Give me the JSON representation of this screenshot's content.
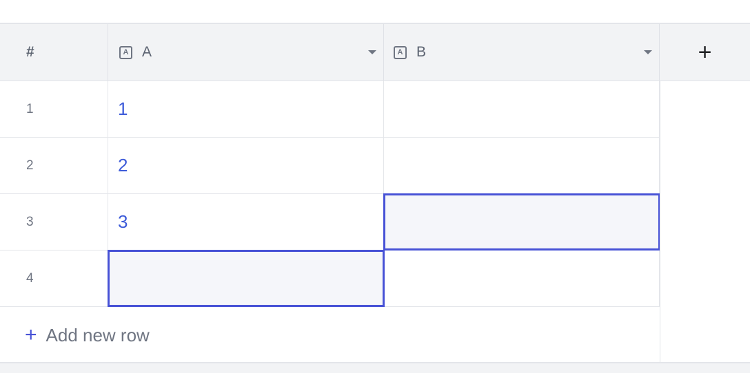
{
  "table": {
    "header": {
      "row_number_label": "#",
      "columns": [
        {
          "name": "A",
          "type_icon": "text-type-icon"
        },
        {
          "name": "B",
          "type_icon": "text-type-icon"
        }
      ],
      "add_column_label": "+"
    },
    "rows": [
      {
        "number": "1",
        "a": "1",
        "b": ""
      },
      {
        "number": "2",
        "a": "2",
        "b": ""
      },
      {
        "number": "3",
        "a": "3",
        "b": ""
      },
      {
        "number": "4",
        "a": "",
        "b": ""
      }
    ],
    "selected_cells": [
      "row3-b",
      "row4-a"
    ],
    "add_row": {
      "icon": "+",
      "label": "Add new row"
    },
    "colors": {
      "accent": "#4752d6",
      "value_text": "#3d5bd9",
      "header_bg": "#f2f3f5"
    }
  }
}
